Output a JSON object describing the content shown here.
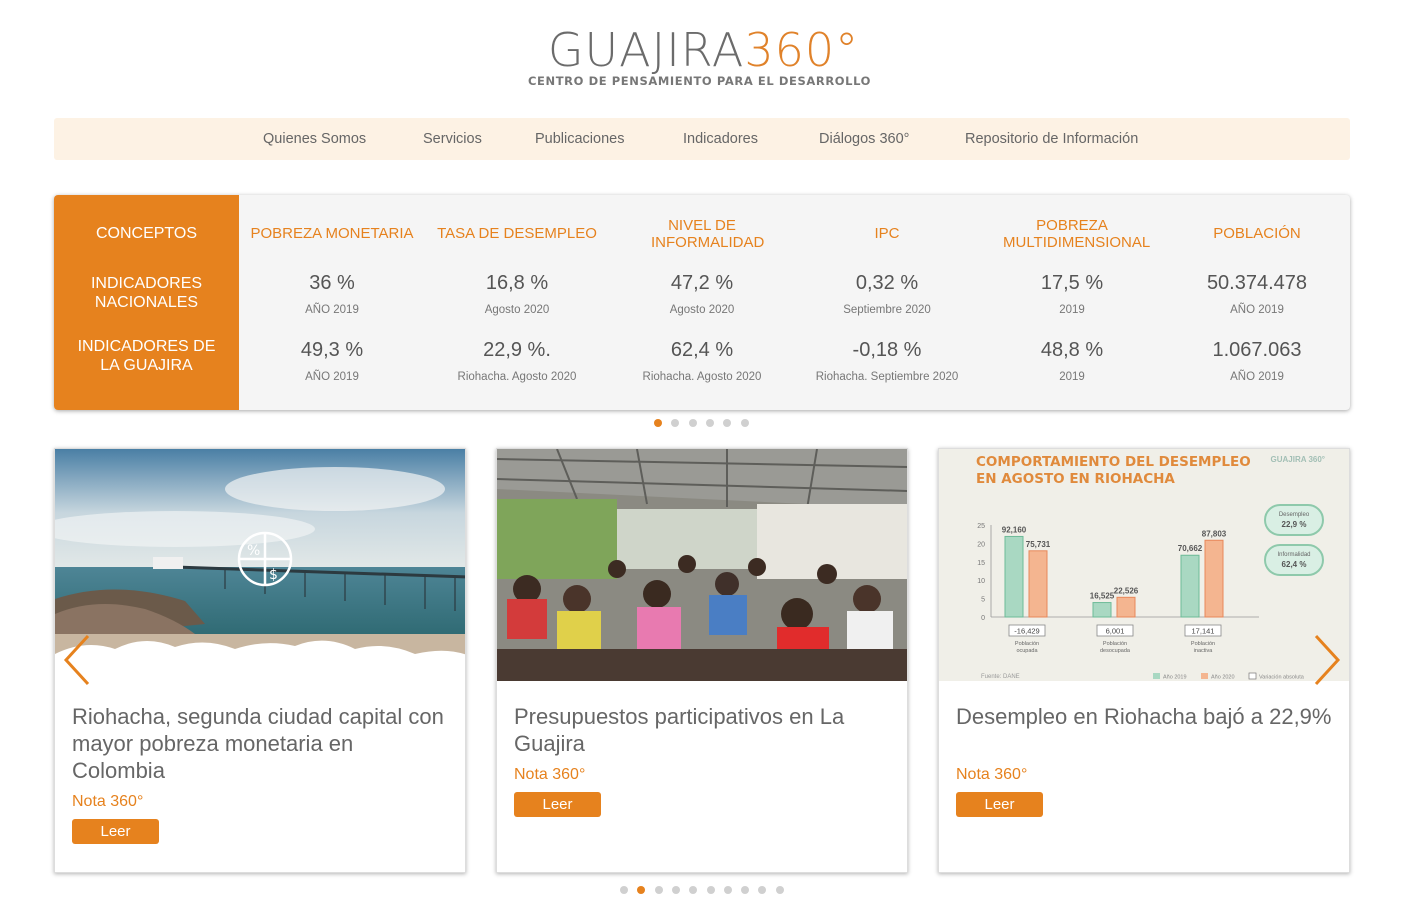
{
  "logo": {
    "brand": "GUAJIRA",
    "number": "360°",
    "tagline": "CENTRO DE PENSAMIENTO PARA EL DESARROLLO"
  },
  "nav": {
    "items": [
      {
        "label": "Quienes Somos"
      },
      {
        "label": "Servicios"
      },
      {
        "label": "Publicaciones"
      },
      {
        "label": "Indicadores"
      },
      {
        "label": "Diálogos 360°"
      },
      {
        "label": "Repositorio de Información"
      }
    ]
  },
  "indicators": {
    "side": {
      "concepts": "CONCEPTOS",
      "national": "INDICADORES NACIONALES",
      "guajira": "INDICADORES DE LA GUAJIRA"
    },
    "columns": [
      {
        "heading": "POBREZA MONETARIA",
        "national_value": "36 %",
        "national_note": "AÑO 2019",
        "guajira_value": "49,3 %",
        "guajira_note": "AÑO 2019"
      },
      {
        "heading": "TASA DE DESEMPLEO",
        "national_value": "16,8 %",
        "national_note": "Agosto 2020",
        "guajira_value": "22,9 %.",
        "guajira_note": "Riohacha. Agosto 2020"
      },
      {
        "heading": "NIVEL DE INFORMALIDAD",
        "national_value": "47,2 %",
        "national_note": "Agosto 2020",
        "guajira_value": "62,4 %",
        "guajira_note": "Riohacha. Agosto 2020"
      },
      {
        "heading": "IPC",
        "national_value": "0,32 %",
        "national_note": "Septiembre 2020",
        "guajira_value": "-0,18 %",
        "guajira_note": "Riohacha. Septiembre 2020"
      },
      {
        "heading": "POBREZA MULTIDIMENSIONAL",
        "national_value": "17,5 %",
        "national_note": "2019",
        "guajira_value": "48,8 %",
        "guajira_note": "2019"
      },
      {
        "heading": "POBLACIÓN",
        "national_value": "50.374.478",
        "national_note": "AÑO 2019",
        "guajira_value": "1.067.063",
        "guajira_note": "AÑO 2019"
      }
    ],
    "pager": {
      "count": 6,
      "active": 0
    }
  },
  "news": {
    "cards": [
      {
        "title": "Riohacha, segunda ciudad capital con mayor pobreza monetaria en Colombia",
        "note": "Nota 360°",
        "button": "Leer"
      },
      {
        "title": "Presupuestos participativos en La Guajira",
        "note": "Nota 360°",
        "button": "Leer"
      },
      {
        "title": "Desempleo en Riohacha bajó a 22,9%",
        "note": "Nota 360°",
        "button": "Leer"
      }
    ],
    "pager": {
      "count": 10,
      "active": 1
    }
  },
  "chart_image": {
    "title_line1": "COMPORTAMIENTO DEL DESEMPLEO",
    "title_line2": "EN AGOSTO EN RIOHACHA",
    "brand": "GUAJIRA 360°",
    "badge1_label": "Desempleo",
    "badge1_value": "22,9 %",
    "badge2_label": "Informalidad",
    "badge2_value": "62,4 %",
    "y_ticks": [
      "25",
      "20",
      "15",
      "10",
      "5",
      "0"
    ],
    "groups": [
      {
        "v2019": "92,160",
        "v2020": "75,731",
        "diff": "-16,429",
        "label1": "Población",
        "label2": "ocupada"
      },
      {
        "v2019": "16,525",
        "v2020": "22,526",
        "diff": "6,001",
        "label1": "Población",
        "label2": "desocupada"
      },
      {
        "v2019": "70,662",
        "v2020": "87,803",
        "diff": "17,141",
        "label1": "Población",
        "label2": "inactiva"
      }
    ],
    "source": "Fuente: DANE",
    "legend_2019": "Año 2019",
    "legend_2020": "Año 2020",
    "legend_var": "Variación absoluta"
  },
  "colors": {
    "accent": "#e6821e",
    "nav_bg": "#fdf2e4",
    "card_bg": "#f5f5f5"
  }
}
